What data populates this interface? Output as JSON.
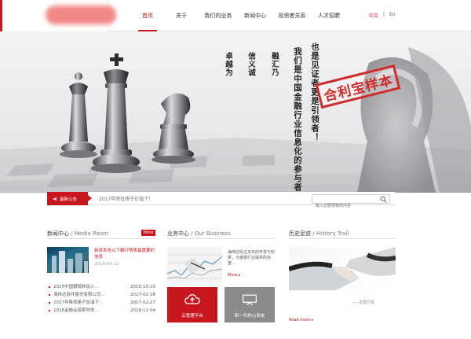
{
  "nav": {
    "items": [
      {
        "label": "首页",
        "active": true
      },
      {
        "label": "关于",
        "active": false
      },
      {
        "label": "我们的业务",
        "active": false
      },
      {
        "label": "新闻中心",
        "active": false
      },
      {
        "label": "投资者关系",
        "active": false
      },
      {
        "label": "人才招聘",
        "active": false
      }
    ],
    "lang_cn": "中文",
    "lang_sep": "|",
    "lang_en": "En"
  },
  "hero": {
    "col1": "卓越为",
    "col2": "信义诚",
    "col3": "融汇乃",
    "slogan_a": "我们是中国金融行业信息化的参与者",
    "slogan_b": "也是见证者更是引领者！",
    "stamp": "合利宝样本"
  },
  "notice": {
    "tag": "最新公告",
    "text": "2017年降低格子价值下！"
  },
  "search": {
    "placeholder": "输入您要搜索的内容"
  },
  "news": {
    "title": "新闻中心",
    "title_en": "/ Media Room",
    "more": "More",
    "headline": "新资本告以下载行情表最重要的信息",
    "headline_date": "2014-06-12",
    "items": [
      {
        "title": "2015中国银局新加入...",
        "date": "2015-10-15"
      },
      {
        "title": "海伟达软件股份有限公司...",
        "date": "2017-02-28"
      },
      {
        "title": "2017年降低格子加油下...",
        "date": "2017-02-27"
      },
      {
        "title": "2016金融云探索你你...",
        "date": "2016-11-04"
      }
    ]
  },
  "business": {
    "title": "业务中心",
    "title_en": "/ Our Business",
    "text": "海伟达经过多年的开发与积累，为金融行业提供的完整...",
    "more": "More ▸",
    "tile1": "云管理平台",
    "tile2": "新一代核心系统"
  },
  "history": {
    "title": "历史足迹",
    "title_en": "/ History Trail",
    "caption": "——发展历程",
    "more": "Read more ▸"
  },
  "colors": {
    "brand_red": "#c7161d",
    "tile_gray": "#8b8b8b"
  }
}
